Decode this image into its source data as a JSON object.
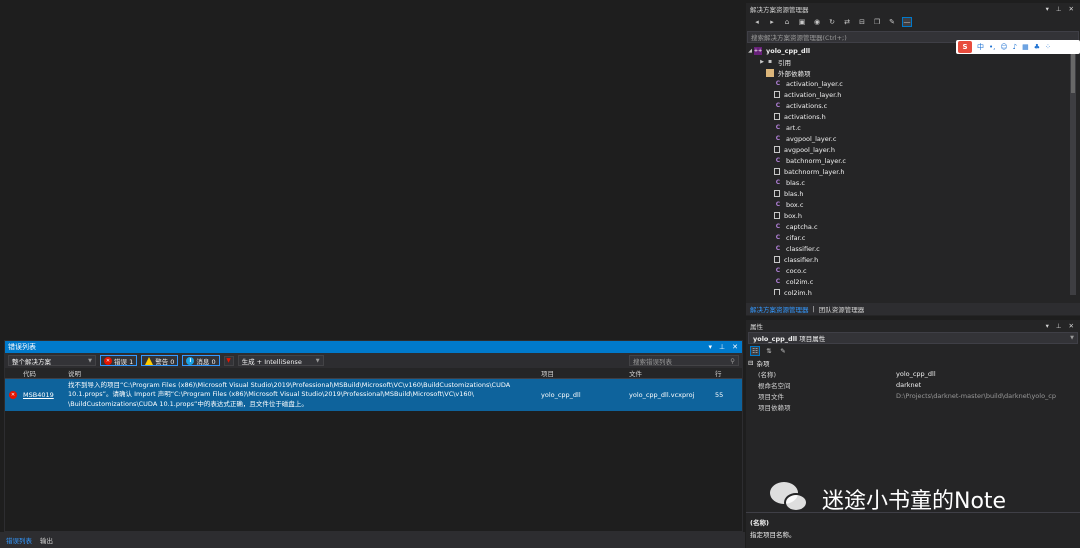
{
  "error_list": {
    "title": "错误列表",
    "scope": "整个解决方案",
    "errors_label": "错误 1",
    "warnings_label": "警告 0",
    "messages_label": "消息 0",
    "build_filter": "生成 + IntelliSense",
    "search_placeholder": "搜索错误列表",
    "columns": {
      "code": "代码",
      "desc": "说明",
      "project": "项目",
      "file": "文件",
      "line": "行"
    },
    "rows": [
      {
        "code": "MSB4019",
        "desc": "找不到导入的项目“C:\\Program Files (x86)\\Microsoft Visual Studio\\2019\\Professional\\MSBuild\\Microsoft\\VC\\v160\\BuildCustomizations\\CUDA 10.1.props”。请确认 Import 声明“C:\\Program Files (x86)\\Microsoft Visual Studio\\2019\\Professional\\MSBuild\\Microsoft\\VC\\v160\\ \\BuildCustomizations\\CUDA 10.1.props”中的表达式正确，且文件位于磁盘上。",
        "project": "yolo_cpp_dll",
        "file": "yolo_cpp_dll.vcxproj",
        "line": "55"
      }
    ]
  },
  "bottom_tabs": [
    "错误列表",
    "输出"
  ],
  "solution_explorer": {
    "title": "解决方案资源管理器",
    "search_placeholder": "搜索解决方案资源管理器(Ctrl+;)",
    "project": "yolo_cpp_dll",
    "references": "引用",
    "external_deps": "外部依赖项",
    "files": [
      "activation_layer.c",
      "activation_layer.h",
      "activations.c",
      "activations.h",
      "art.c",
      "avgpool_layer.c",
      "avgpool_layer.h",
      "batchnorm_layer.c",
      "batchnorm_layer.h",
      "blas.c",
      "blas.h",
      "box.c",
      "box.h",
      "captcha.c",
      "cifar.c",
      "classifier.c",
      "classifier.h",
      "coco.c",
      "col2im.c",
      "col2im.h"
    ],
    "tabs": [
      "解决方案资源管理器",
      "团队资源管理器"
    ],
    "ime_logo": "S",
    "ime_lang": "中"
  },
  "properties": {
    "title": "属性",
    "object_name": "yolo_cpp_dll",
    "object_type": "项目属性",
    "category": "杂项",
    "rows": [
      {
        "key": "(名称)",
        "value": "yolo_cpp_dll"
      },
      {
        "key": "根命名空间",
        "value": "darknet"
      },
      {
        "key": "项目文件",
        "value": "D:\\Projects\\darknet-master\\build\\darknet\\yolo_cp"
      },
      {
        "key": "项目依赖项",
        "value": ""
      }
    ],
    "desc_title": "(名称)",
    "desc_text": "指定项目名称。"
  },
  "watermark": "迷途小书童的Note",
  "colors": {
    "accent": "#007acc",
    "selection": "#0e639c",
    "error": "#e51400"
  }
}
